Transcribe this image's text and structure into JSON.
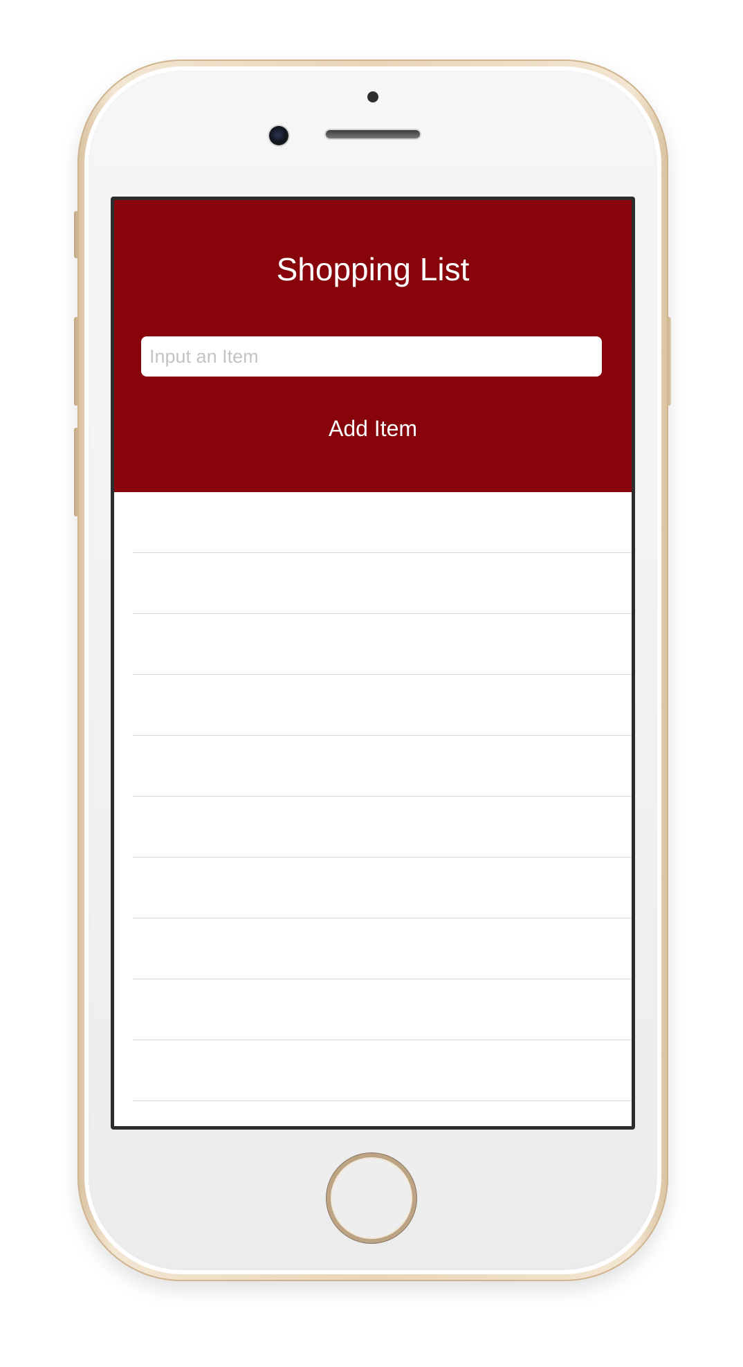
{
  "app": {
    "title": "Shopping List",
    "input": {
      "value": "",
      "placeholder": "Input an Item"
    },
    "add_button_label": "Add Item",
    "list_items": [
      "",
      "",
      "",
      "",
      "",
      "",
      "",
      "",
      "",
      ""
    ]
  },
  "colors": {
    "header_background": "#86040a",
    "header_text": "#ffffff",
    "input_placeholder": "#c3c3c8",
    "row_separator": "#d5d5d8",
    "device_frame": "#e9d5b8"
  },
  "icons": {
    "home_button": "home-button-ring",
    "camera": "front-camera-icon",
    "speaker": "earpiece-speaker"
  }
}
